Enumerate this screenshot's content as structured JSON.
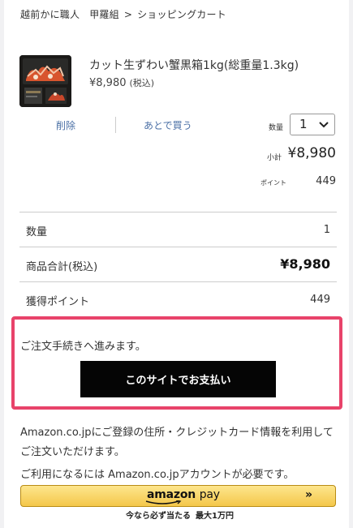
{
  "breadcrumb": {
    "shop": "越前かに職人",
    "store": "甲羅組",
    "separator": ">",
    "current": "ショッピングカート"
  },
  "product": {
    "name": "カット生ずわい蟹黒箱1kg(総重量1.3kg)",
    "price": "¥8,980",
    "tax_note": "(税込)",
    "delete_label": "削除",
    "later_label": "あとで買う",
    "qty_label": "数量",
    "qty_value": "1",
    "subtotal_label": "小計",
    "subtotal": "¥8,980",
    "points_label": "ポイント",
    "points": "449"
  },
  "summary": {
    "qty_label": "数量",
    "qty_value": "1",
    "total_label": "商品合計(税込)",
    "total_value": "¥8,980",
    "points_label": "獲得ポイント",
    "points_value": "449"
  },
  "checkout": {
    "proceed_text": "ご注文手続きへ進みます。",
    "pay_button": "このサイトでお支払い"
  },
  "amazon": {
    "desc1": "Amazon.co.jpにご登録の住所・クレジットカード情報を利用してご注文いただけます。",
    "desc2": "ご利用になるには Amazon.co.jpアカウントが必要です。",
    "logo_amazon": "amazon",
    "logo_pay": "pay",
    "chevron": "»",
    "promo1": "今なら必ず当たる",
    "promo2": "最大1万円"
  },
  "colors": {
    "highlight": "#e8436a",
    "pay_button_bg": "#050505",
    "amazon_button": "#f4c74a",
    "link": "#4a6fa5"
  }
}
